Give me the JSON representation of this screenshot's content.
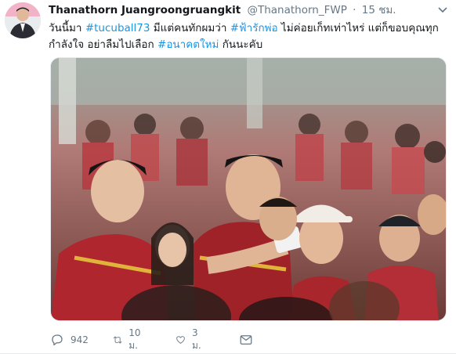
{
  "tweet": {
    "author_name": "Thanathorn Juangroongruangkit",
    "author_handle": "@Thanathorn_FWP",
    "separator": "·",
    "time": "15 ชม.",
    "text_parts": {
      "t1": "วันนี้มา ",
      "h1": "#tucuball73",
      "t2": " มีแต่คนทักผมว่า ",
      "h2": "#ฟ้ารักพ่อ",
      "t3": " ไม่ค่อยเก็ทเท่าไหร่ แต่ก็ขอบคุณทุกกำลังใจ อย่าลืมไปเลือก ",
      "h3": "#อนาคตใหม่",
      "t4": " กันนะคับ"
    },
    "hashtag_color": "#1b95e0"
  },
  "actions": {
    "reply_count": "942",
    "retweet_count": "10 ม.",
    "like_count": "3 ม.",
    "icons": [
      "reply-icon",
      "retweet-icon",
      "heart-icon",
      "message-icon"
    ]
  }
}
